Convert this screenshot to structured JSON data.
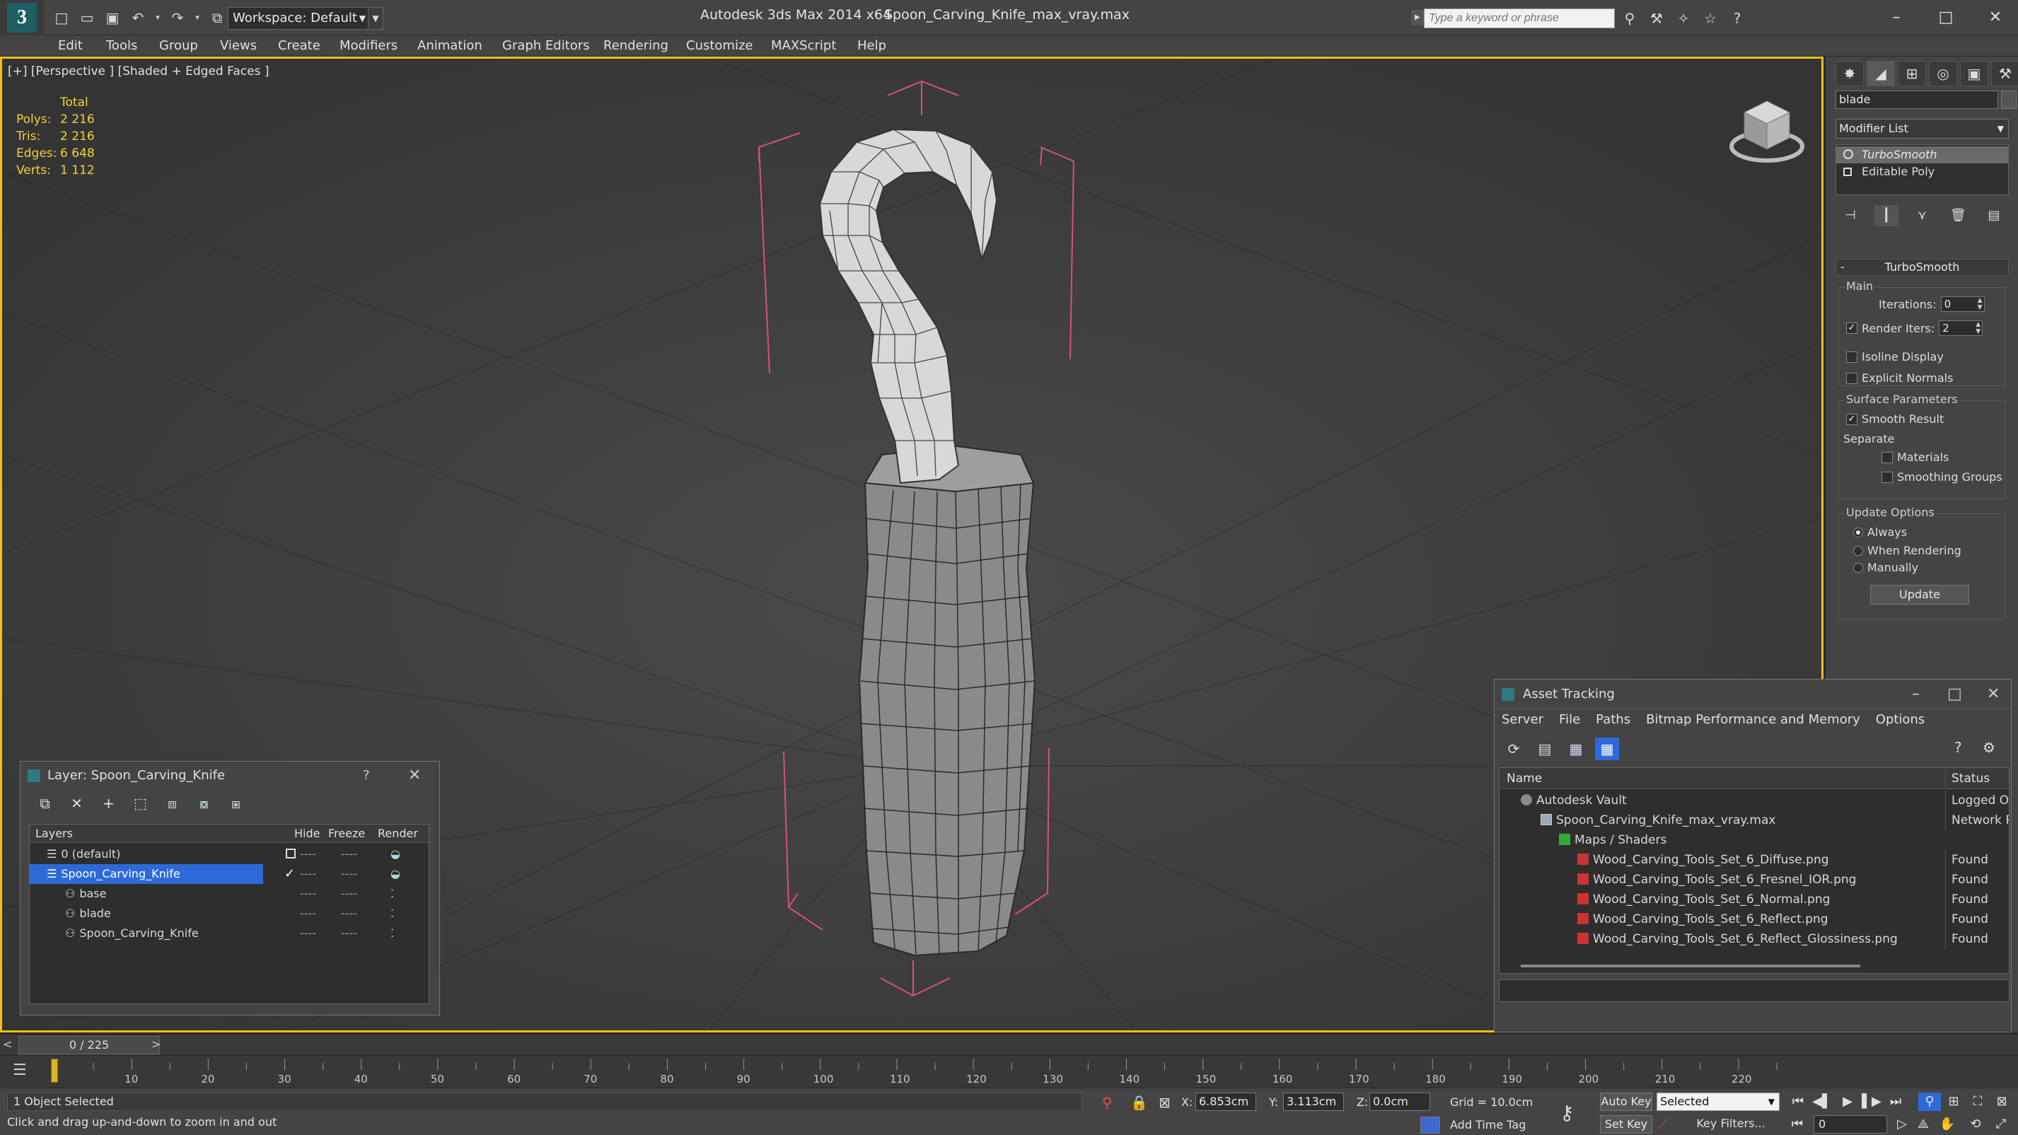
{
  "titlebar": {
    "workspace": "Workspace: Default",
    "app_title": "Autodesk 3ds Max  2014 x64",
    "file_title": "Spoon_Carving_Knife_max_vray.max",
    "search_placeholder": "Type a keyword or phrase"
  },
  "menu": [
    "Edit",
    "Tools",
    "Group",
    "Views",
    "Create",
    "Modifiers",
    "Animation",
    "Graph Editors",
    "Rendering",
    "Customize",
    "MAXScript",
    "Help"
  ],
  "viewport": {
    "label": "[+] [Perspective ] [Shaded + Edged Faces ]",
    "stats": {
      "header": "Total",
      "rows": [
        {
          "label": "Polys:",
          "value": "2 216"
        },
        {
          "label": "Tris:",
          "value": "2 216"
        },
        {
          "label": "Edges:",
          "value": "6 648"
        },
        {
          "label": "Verts:",
          "value": "1 112"
        }
      ]
    }
  },
  "command_panel": {
    "object_name": "blade",
    "modifier_list": "Modifier List",
    "stack": [
      "TurboSmooth",
      "Editable Poly"
    ],
    "turbosmooth": {
      "title": "TurboSmooth",
      "main_label": "Main",
      "iterations_label": "Iterations:",
      "iterations_value": "0",
      "render_iters_label": "Render Iters:",
      "render_iters_value": "2",
      "isoline_display": "Isoline Display",
      "explicit_normals": "Explicit Normals",
      "surface_parameters": "Surface Parameters",
      "smooth_result": "Smooth Result",
      "separate": "Separate",
      "materials": "Materials",
      "smoothing_groups": "Smoothing Groups",
      "update_options": "Update Options",
      "always": "Always",
      "when_rendering": "When Rendering",
      "manually": "Manually",
      "update_button": "Update"
    }
  },
  "layer_dialog": {
    "title": "Layer: Spoon_Carving_Knife",
    "help": "?",
    "columns": {
      "layers": "Layers",
      "hide": "Hide",
      "freeze": "Freeze",
      "render": "Render"
    },
    "rows": [
      {
        "name": "0 (default)",
        "indent": 0
      },
      {
        "name": "Spoon_Carving_Knife",
        "indent": 0
      },
      {
        "name": "base",
        "indent": 1
      },
      {
        "name": "blade",
        "indent": 1
      },
      {
        "name": "Spoon_Carving_Knife",
        "indent": 1
      }
    ],
    "dash": "----"
  },
  "asset_tracking": {
    "title": "Asset Tracking",
    "menu": [
      "Server",
      "File",
      "Paths",
      "Bitmap Performance and Memory",
      "Options"
    ],
    "columns": {
      "name": "Name",
      "status": "Status"
    },
    "rows": [
      {
        "name": "Autodesk Vault",
        "status": "Logged Out",
        "indent": 1
      },
      {
        "name": "Spoon_Carving_Knife_max_vray.max",
        "status": "Network Pa",
        "indent": 2
      },
      {
        "name": "Maps / Shaders",
        "status": "",
        "indent": 3
      },
      {
        "name": "Wood_Carving_Tools_Set_6_Diffuse.png",
        "status": "Found",
        "indent": 4
      },
      {
        "name": "Wood_Carving_Tools_Set_6_Fresnel_IOR.png",
        "status": "Found",
        "indent": 4
      },
      {
        "name": "Wood_Carving_Tools_Set_6_Normal.png",
        "status": "Found",
        "indent": 4
      },
      {
        "name": "Wood_Carving_Tools_Set_6_Reflect.png",
        "status": "Found",
        "indent": 4
      },
      {
        "name": "Wood_Carving_Tools_Set_6_Reflect_Glossiness.png",
        "status": "Found",
        "indent": 4
      }
    ]
  },
  "timeline": {
    "frame_display": "0 / 225",
    "left_arrow": "<",
    "right_arrow": ">",
    "ticks": [
      "10",
      "20",
      "30",
      "40",
      "50",
      "60",
      "70",
      "80",
      "90",
      "100",
      "110",
      "120",
      "130",
      "140",
      "150",
      "160",
      "170",
      "180",
      "190",
      "200",
      "210",
      "220"
    ]
  },
  "statusbar": {
    "selection": "1 Object Selected",
    "prompt": "Click and drag up-and-down to zoom in and out",
    "x_label": "X:",
    "x_value": "6.853cm",
    "y_label": "Y:",
    "y_value": "3.113cm",
    "z_label": "Z:",
    "z_value": "0.0cm",
    "grid": "Grid = 10.0cm",
    "add_time_tag": "Add Time Tag",
    "auto_key": "Auto Key",
    "set_key": "Set Key",
    "selected": "Selected",
    "key_filters": "Key Filters...",
    "current_frame": "0"
  },
  "colors": {
    "viewport_border": "#f0c018",
    "stats": "#f5d033",
    "selection_blue": "#2d6ad8",
    "gizmo_pink": "#d8507a"
  }
}
